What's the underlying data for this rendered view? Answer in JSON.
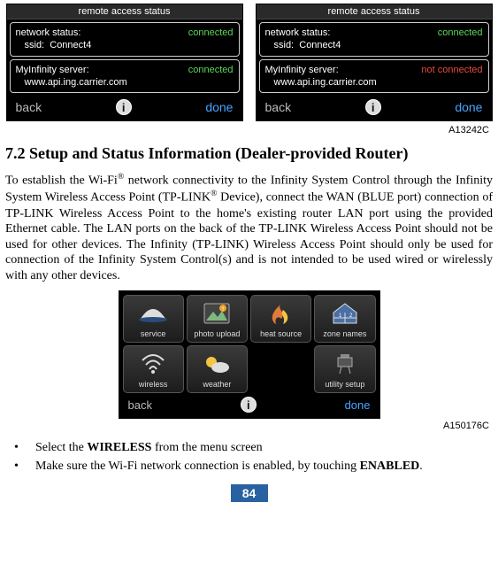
{
  "screen_a": {
    "title": "remote access status",
    "network_label": "network status:",
    "network_status": "connected",
    "ssid_label": "ssid:",
    "ssid_value": "Connect4",
    "server_label": "MyInfinity server:",
    "server_status": "connected",
    "server_url": "www.api.ing.carrier.com",
    "back": "back",
    "done": "done"
  },
  "screen_b": {
    "title": "remote access status",
    "network_label": "network status:",
    "network_status": "connected",
    "ssid_label": "ssid:",
    "ssid_value": "Connect4",
    "server_label": "MyInfinity server:",
    "server_status": "not connected",
    "server_url": "www.api.ing.carrier.com",
    "back": "back",
    "done": "done"
  },
  "fig_id_top": "A13242C",
  "heading": "7.2 Setup and Status Information (Dealer-provided Router)",
  "paragraph": "To establish the Wi-Fi® network connectivity to the Infinity System Control through the Infinity System Wireless Access Point (TP-LINK® Device), connect the WAN (BLUE port) connection of TP-LINK Wireless Access Point to the home's existing router LAN port using the provided Ethernet cable. The LAN ports on the back of the TP-LINK Wireless Access Point should not be used for other devices. The Infinity (TP-LINK) Wireless Access Point should only be used for connection of the Infinity System Control(s) and is not intended to be used wired or wirelessly with any other devices.",
  "menu": {
    "items": [
      {
        "label": "service"
      },
      {
        "label": "photo upload"
      },
      {
        "label": "heat source"
      },
      {
        "label": "zone names"
      },
      {
        "label": "wireless"
      },
      {
        "label": "weather"
      },
      {
        "label": ""
      },
      {
        "label": "utility setup"
      }
    ],
    "back": "back",
    "done": "done"
  },
  "fig_id_mid": "A150176C",
  "bullets": [
    {
      "pre": "Select the ",
      "bold": "WIRELESS",
      "post": " from the menu screen"
    },
    {
      "pre": "Make sure the Wi-Fi network connection is enabled, by touching ",
      "bold": "ENABLED",
      "post": "."
    }
  ],
  "page_number": "84",
  "info_glyph": "i"
}
